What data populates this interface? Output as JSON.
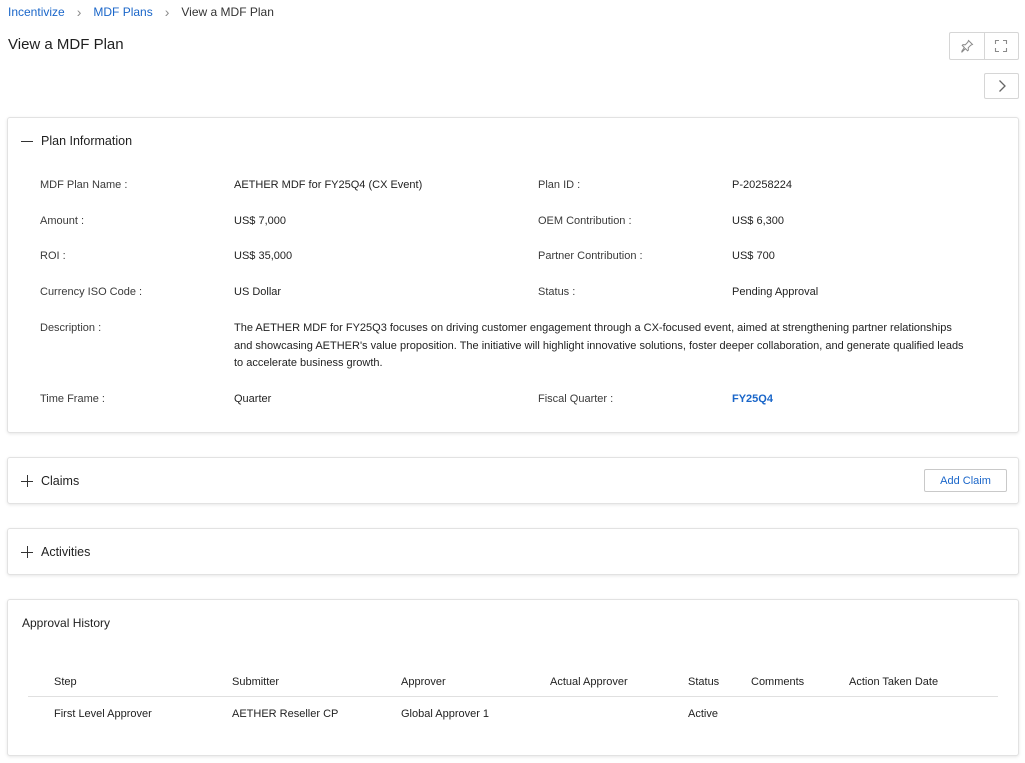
{
  "breadcrumb": {
    "items": [
      "Incentivize",
      "MDF Plans"
    ],
    "current": "View a MDF Plan"
  },
  "page": {
    "title": "View a MDF Plan"
  },
  "plan_info": {
    "title": "Plan Information",
    "fields": {
      "plan_name_label": "MDF Plan Name :",
      "plan_name_value": "AETHER MDF for FY25Q4 (CX Event)",
      "plan_id_label": "Plan ID :",
      "plan_id_value": "P-20258224",
      "amount_label": "Amount :",
      "amount_value": "US$ 7,000",
      "oem_label": "OEM Contribution :",
      "oem_value": "US$ 6,300",
      "roi_label": "ROI :",
      "roi_value": "US$ 35,000",
      "partner_label": "Partner Contribution :",
      "partner_value": "US$ 700",
      "currency_label": "Currency ISO Code :",
      "currency_value": "US Dollar",
      "status_label": "Status :",
      "status_value": "Pending Approval",
      "description_label": "Description :",
      "description_value": "The AETHER MDF for FY25Q3 focuses on driving customer engagement through a CX-focused event, aimed at strengthening partner relationships and showcasing AETHER's value proposition. The initiative will highlight innovative solutions, foster deeper collaboration, and generate qualified leads to accelerate business growth.",
      "timeframe_label": "Time Frame :",
      "timeframe_value": "Quarter",
      "fiscal_label": "Fiscal Quarter :",
      "fiscal_value": "FY25Q4"
    }
  },
  "claims": {
    "title": "Claims",
    "add_label": "Add Claim"
  },
  "activities": {
    "title": "Activities"
  },
  "approval_history": {
    "title": "Approval History",
    "columns": [
      "Step",
      "Submitter",
      "Approver",
      "Actual Approver",
      "Status",
      "Comments",
      "Action Taken Date"
    ],
    "rows": [
      {
        "step": "First Level Approver",
        "submitter": "AETHER Reseller CP",
        "approver": "Global Approver 1",
        "actual_approver": "",
        "status": "Active",
        "comments": "",
        "action_date": ""
      }
    ]
  },
  "colors": {
    "link": "#1a66c9",
    "border": "#e2e2e2"
  },
  "icons": {
    "pin": "pin-icon",
    "expand": "expand-icon",
    "next": "chevron-right-icon",
    "collapse": "minus-icon",
    "expand_section": "plus-icon"
  }
}
